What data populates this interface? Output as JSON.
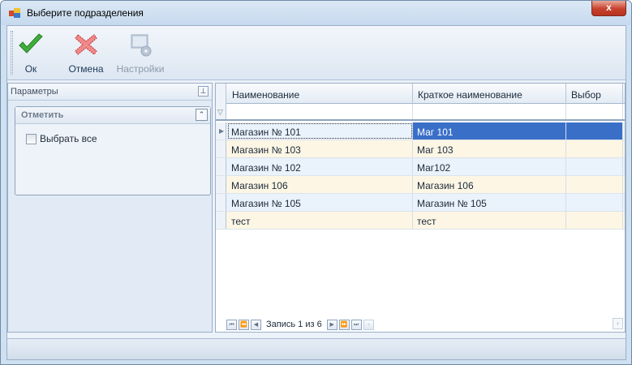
{
  "window": {
    "title": "Выберите подразделения",
    "close_label": "x"
  },
  "toolbar": {
    "ok_label": "Ок",
    "cancel_label": "Отмена",
    "settings_label": "Настройки"
  },
  "left_panel": {
    "title": "Параметры",
    "group_title": "Отметить",
    "select_all_label": "Выбрать все",
    "select_all_checked": false
  },
  "grid": {
    "columns": [
      "Наименование",
      "Краткое наименование",
      "Выбор"
    ],
    "rows": [
      {
        "name": "Магазин № 101",
        "short": "Маг 101",
        "choice": ""
      },
      {
        "name": "Магазин № 103",
        "short": "Маг 103",
        "choice": ""
      },
      {
        "name": "Магазин № 102",
        "short": "Маг102",
        "choice": ""
      },
      {
        "name": "Магазин 106",
        "short": "Магазин 106",
        "choice": ""
      },
      {
        "name": "Магазин № 105",
        "short": "Магазин № 105",
        "choice": ""
      },
      {
        "name": "тест",
        "short": "тест",
        "choice": ""
      }
    ],
    "selected_row": 0,
    "navigator_text": "Запись 1 из 6"
  },
  "colors": {
    "selection": "#3a6fc8",
    "row_alt_blue": "#eaf2fb",
    "row_alt_cream": "#fdf6e4"
  }
}
